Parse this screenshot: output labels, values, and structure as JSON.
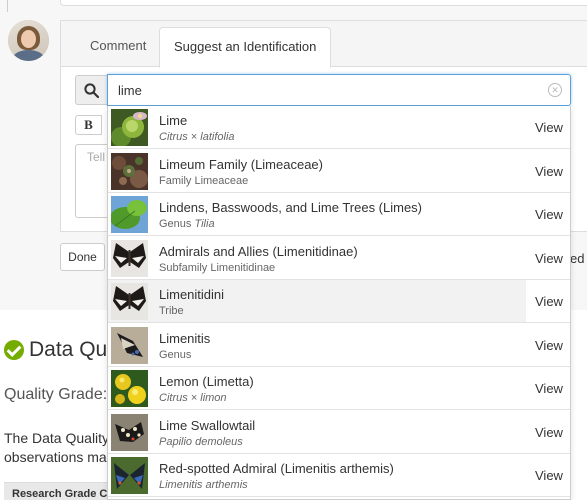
{
  "tabs": [
    {
      "label": "Comment"
    },
    {
      "label": "Suggest an Identification"
    }
  ],
  "search": {
    "value": "lime",
    "clear_glyph": "✕"
  },
  "editor": {
    "bold_label": "B",
    "placeholder": "Tell"
  },
  "actions": {
    "done_label": "Done",
    "trailing_fragment": "ed"
  },
  "data_quality": {
    "title": "Data Qu",
    "quality_grade_label": "Quality Grade:",
    "description_line1": "The Data Quality",
    "description_line2": "observations ma",
    "research_grade_header": "Research Grade C"
  },
  "results": [
    {
      "name": "Lime",
      "rank": "",
      "sci": "Citrus × latifolia",
      "italic": true,
      "view": "View",
      "thumb": "lime-fruit"
    },
    {
      "name": "Limeum Family (Limeaceae)",
      "rank": "Family",
      "sci": "Limeaceae",
      "italic": false,
      "view": "View",
      "thumb": "limeum-plant"
    },
    {
      "name": "Lindens, Basswoods, and Lime Trees (Limes)",
      "rank": "Genus",
      "sci": "Tilia",
      "italic": true,
      "view": "View",
      "thumb": "linden-leaves"
    },
    {
      "name": "Admirals and Allies (Limenitidinae)",
      "rank": "Subfamily",
      "sci": "Limenitidinae",
      "italic": false,
      "view": "View",
      "thumb": "admiral-butterfly"
    },
    {
      "name": "Limenitidini",
      "rank": "",
      "sci": "Tribe",
      "italic": false,
      "view": "View",
      "thumb": "admiral-butterfly"
    },
    {
      "name": "Limenitis",
      "rank": "",
      "sci": "Genus",
      "italic": false,
      "view": "View",
      "thumb": "limenitis-butterfly"
    },
    {
      "name": "Lemon (Limetta)",
      "rank": "",
      "sci": "Citrus × limon",
      "italic": true,
      "view": "View",
      "thumb": "lemon-fruit"
    },
    {
      "name": "Lime Swallowtail",
      "rank": "",
      "sci": "Papilio demoleus",
      "italic": true,
      "view": "View",
      "thumb": "swallowtail-butterfly"
    },
    {
      "name": "Red-spotted Admiral (Limenitis arthemis)",
      "rank": "",
      "sci": "Limenitis arthemis",
      "italic": true,
      "view": "View",
      "thumb": "red-spotted-admiral"
    }
  ],
  "active_result_index": 4,
  "colors": {
    "accent_blue": "#5ea1d8",
    "check_green": "#74ac00"
  }
}
